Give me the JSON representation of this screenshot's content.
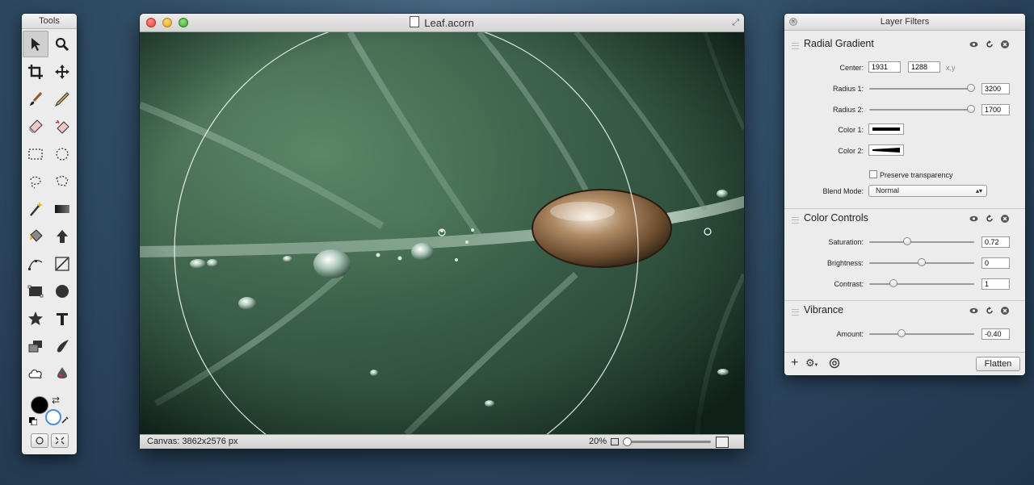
{
  "tools_palette": {
    "title": "Tools",
    "tools": [
      {
        "name": "select-arrow-icon",
        "selected": true
      },
      {
        "name": "zoom-icon"
      },
      {
        "name": "crop-icon"
      },
      {
        "name": "move-icon"
      },
      {
        "name": "brush-icon"
      },
      {
        "name": "pencil-icon"
      },
      {
        "name": "eraser-icon"
      },
      {
        "name": "magic-eraser-icon"
      },
      {
        "name": "rect-select-icon"
      },
      {
        "name": "ellipse-select-icon"
      },
      {
        "name": "lasso-icon"
      },
      {
        "name": "polygon-lasso-icon"
      },
      {
        "name": "magic-wand-icon"
      },
      {
        "name": "gradient-icon"
      },
      {
        "name": "paint-bucket-icon"
      },
      {
        "name": "arrow-up-icon"
      },
      {
        "name": "bezier-icon"
      },
      {
        "name": "line-icon"
      },
      {
        "name": "rect-shape-icon"
      },
      {
        "name": "oval-shape-icon"
      },
      {
        "name": "star-icon"
      },
      {
        "name": "text-icon"
      },
      {
        "name": "clone-icon"
      },
      {
        "name": "smudge-icon"
      },
      {
        "name": "cloud-icon"
      },
      {
        "name": "blur-drop-icon"
      }
    ],
    "foreground_color": "#000000",
    "background_color": "#ffffff"
  },
  "document": {
    "title": "Leaf.acorn",
    "status": "Canvas: 3862x2576 px",
    "zoom": "20%",
    "zoom_fraction": 0.0
  },
  "layer_filters": {
    "title": "Layer Filters",
    "radial_gradient": {
      "title": "Radial Gradient",
      "center_label": "Center:",
      "center_x": "1931",
      "center_y": "1288",
      "xy_hint": "x,y",
      "radius1_label": "Radius 1:",
      "radius1": "3200",
      "radius1_fraction": 0.97,
      "radius2_label": "Radius 2:",
      "radius2": "1700",
      "radius2_fraction": 0.97,
      "color1_label": "Color 1:",
      "color2_label": "Color 2:",
      "preserve_label": "Preserve transparency",
      "preserve_checked": false,
      "blend_label": "Blend Mode:",
      "blend_value": "Normal"
    },
    "color_controls": {
      "title": "Color Controls",
      "saturation_label": "Saturation:",
      "saturation": "0.72",
      "saturation_fraction": 0.36,
      "brightness_label": "Brightness:",
      "brightness": "0",
      "brightness_fraction": 0.5,
      "contrast_label": "Contrast:",
      "contrast": "1",
      "contrast_fraction": 0.23
    },
    "vibrance": {
      "title": "Vibrance",
      "amount_label": "Amount:",
      "amount": "-0.40",
      "amount_fraction": 0.31
    },
    "flatten_label": "Flatten"
  }
}
